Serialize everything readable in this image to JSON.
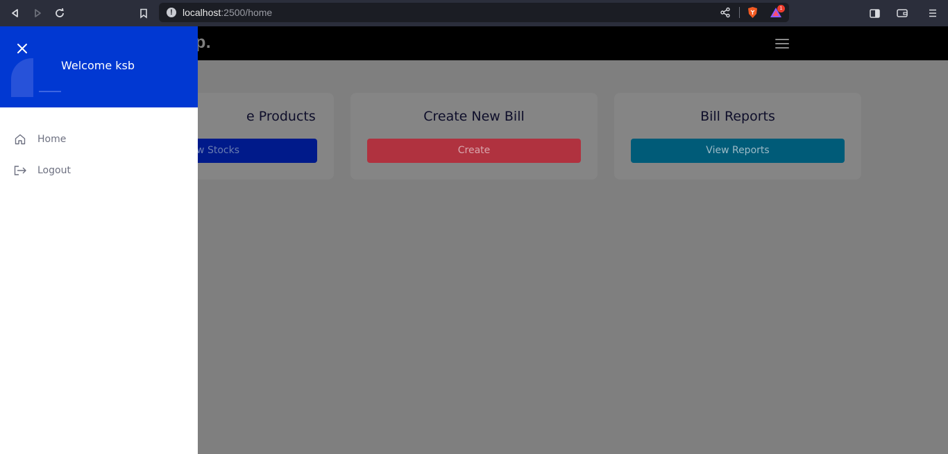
{
  "browser": {
    "url_host": "localhost",
    "url_path": ":2500/home",
    "notification_count": "1"
  },
  "navbar": {
    "brand": "hop."
  },
  "cards": [
    {
      "title": "e Products",
      "button": "w Stocks",
      "button_color": "#001a8a",
      "button_text_color": "#6a7db0"
    },
    {
      "title": "Create New Bill",
      "button": "Create",
      "button_color": "#b0323f",
      "button_text_color": "#d8a7ad"
    },
    {
      "title": "Bill Reports",
      "button": "View Reports",
      "button_color": "#005b78",
      "button_text_color": "#9cbac6"
    }
  ],
  "drawer": {
    "welcome": "Welcome ksb",
    "accent_color": "#0138d2",
    "items": [
      {
        "label": "Home",
        "icon": "home-icon"
      },
      {
        "label": "Logout",
        "icon": "logout-icon"
      }
    ]
  }
}
